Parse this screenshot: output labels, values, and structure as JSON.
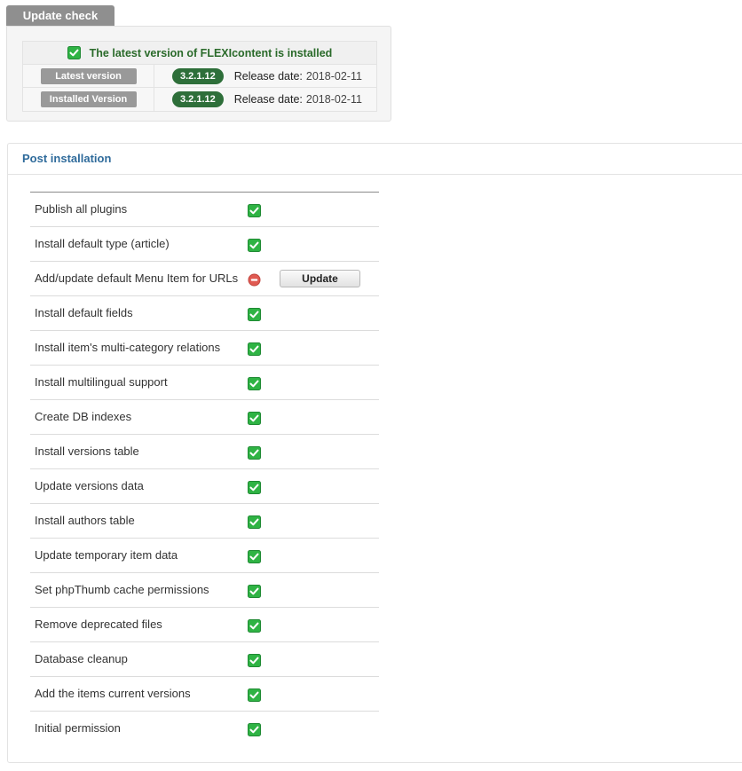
{
  "update_check": {
    "tab_label": "Update check",
    "status_message": "The latest version of FLEXIcontent is installed",
    "rows": [
      {
        "label": "Latest version",
        "version": "3.2.1.12",
        "release_label": "Release date:",
        "release_date": "2018-02-11"
      },
      {
        "label": "Installed Version",
        "version": "3.2.1.12",
        "release_label": "Release date:",
        "release_date": "2018-02-11"
      }
    ]
  },
  "post_installation": {
    "title": "Post installation",
    "update_button_label": "Update",
    "tasks": [
      {
        "name": "Publish all plugins",
        "status": "ok"
      },
      {
        "name": "Install default type (article)",
        "status": "ok"
      },
      {
        "name": "Add/update default Menu Item for URLs",
        "status": "error"
      },
      {
        "name": "Install default fields",
        "status": "ok"
      },
      {
        "name": "Install item's multi-category relations",
        "status": "ok"
      },
      {
        "name": "Install multilingual support",
        "status": "ok"
      },
      {
        "name": "Create DB indexes",
        "status": "ok"
      },
      {
        "name": "Install versions table",
        "status": "ok"
      },
      {
        "name": "Update versions data",
        "status": "ok"
      },
      {
        "name": "Install authors table",
        "status": "ok"
      },
      {
        "name": "Update temporary item data",
        "status": "ok"
      },
      {
        "name": "Set phpThumb cache permissions",
        "status": "ok"
      },
      {
        "name": "Remove deprecated files",
        "status": "ok"
      },
      {
        "name": "Database cleanup",
        "status": "ok"
      },
      {
        "name": "Add the items current versions",
        "status": "ok"
      },
      {
        "name": "Initial permission",
        "status": "ok"
      }
    ]
  },
  "colors": {
    "ok": "#2fb344",
    "error": "#e05a52",
    "badge": "#2e6f3a",
    "label": "#999999",
    "accent": "#2f6b9b"
  },
  "icons": {
    "ok": "check-icon",
    "error": "error-icon"
  }
}
